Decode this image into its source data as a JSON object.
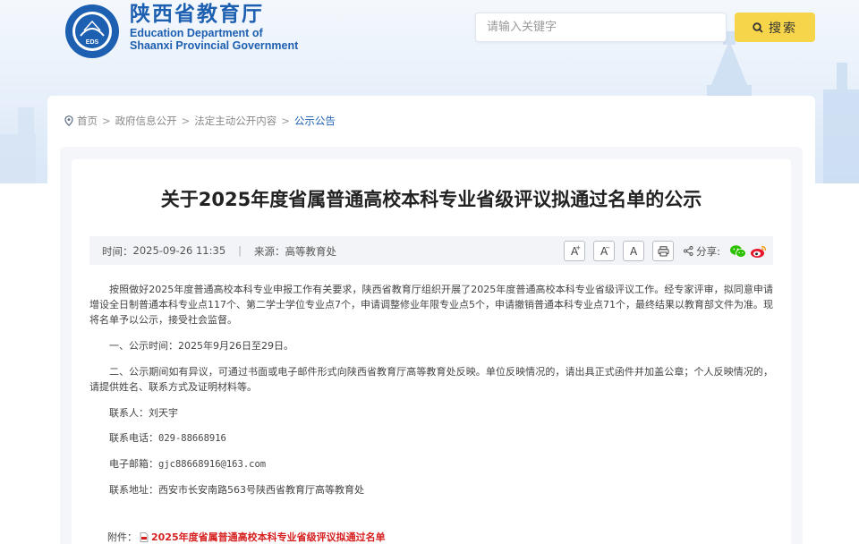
{
  "header": {
    "title_cn": "陕西省教育厅",
    "title_en_line1": "Education Department of",
    "title_en_line2": "Shaanxi Provincial Government",
    "logo_text": "EDS"
  },
  "search": {
    "placeholder": "请输入关键字",
    "button_label": "搜索"
  },
  "breadcrumb": {
    "items": [
      "首页",
      "政府信息公开",
      "法定主动公开内容",
      "公示公告"
    ],
    "separator": ">"
  },
  "article": {
    "title": "关于2025年度省属普通高校本科专业省级评议拟通过名单的公示",
    "time_label": "时间：",
    "time_value": "2025-09-26 11:35",
    "divider": "|",
    "source_label": "来源：",
    "source_value": "高等教育处",
    "font_large": "A",
    "font_small": "A",
    "font_default": "A",
    "share_label": "分享:",
    "paragraphs": [
      "按照做好2025年度普通高校本科专业申报工作有关要求，陕西省教育厅组织开展了2025年度普通高校本科专业省级评议工作。经专家评审，拟同意申请增设全日制普通本科专业点117个、第二学士学位专业点7个，申请调整修业年限专业点5个，申请撤销普通本科专业点71个，最终结果以教育部文件为准。现将名单予以公示，接受社会监督。",
      "一、公示时间：2025年9月26日至29日。",
      "二、公示期间如有异议，可通过书面或电子邮件形式向陕西省教育厅高等教育处反映。单位反映情况的，请出具正式函件并加盖公章；个人反映情况的，请提供姓名、联系方式及证明材料等。"
    ],
    "contact_person_label": "联系人：",
    "contact_person": "刘天宇",
    "phone_label": "联系电话：",
    "phone": "029-88668916",
    "email_label": "电子邮箱：",
    "email": "gjc88668916@163.com",
    "address_label": "联系地址：",
    "address": "西安市长安南路563号陕西省教育厅高等教育处",
    "attachment_label": "附件：",
    "attachment_name": "2025年度省属普通高校本科专业省级评议拟通过名单"
  },
  "colors": {
    "brand_blue": "#1d5fb0",
    "search_button": "#f7d54a",
    "attachment_red": "#d62020"
  }
}
